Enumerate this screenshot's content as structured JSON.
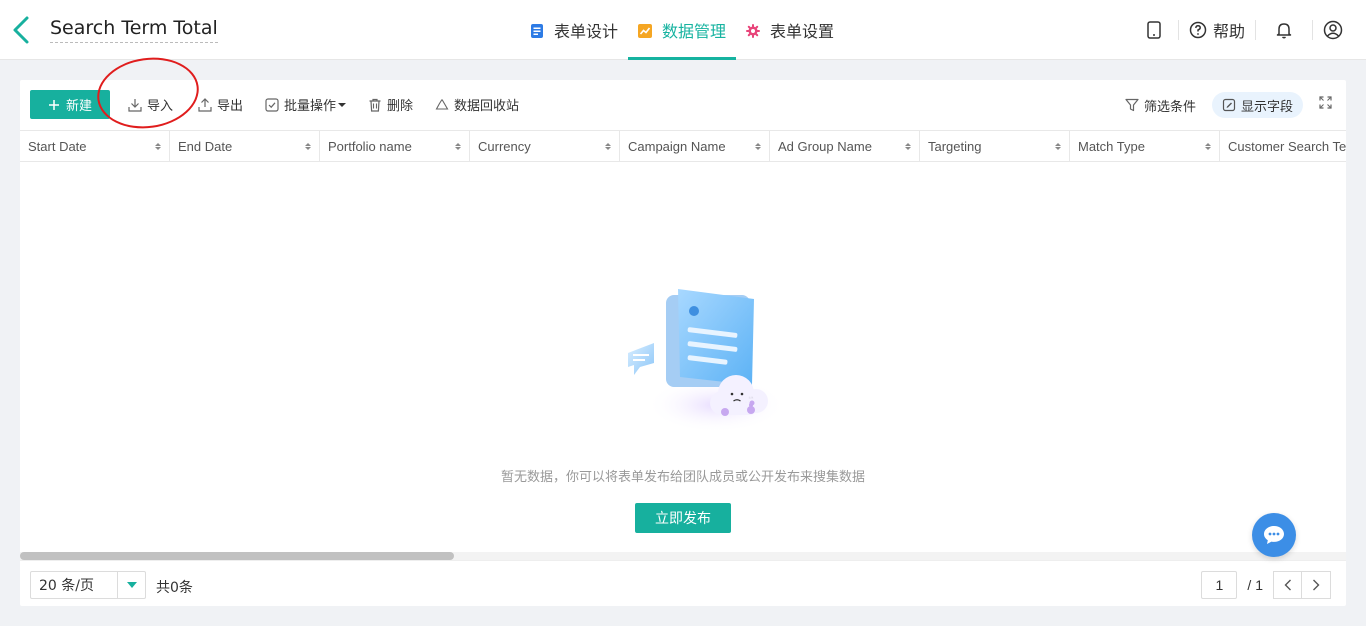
{
  "header": {
    "title": "Search Term Total",
    "tabs": [
      {
        "label": "表单设计",
        "icon": "form-icon"
      },
      {
        "label": "数据管理",
        "icon": "chart-icon"
      },
      {
        "label": "表单设置",
        "icon": "gear-icon"
      }
    ],
    "help_label": "帮助"
  },
  "toolbar": {
    "new_label": "新建",
    "import_label": "导入",
    "export_label": "导出",
    "batch_label": "批量操作",
    "delete_label": "删除",
    "recycle_label": "数据回收站",
    "filter_label": "筛选条件",
    "show_fields_label": "显示字段"
  },
  "table": {
    "columns": [
      "Start Date",
      "End Date",
      "Portfolio name",
      "Currency",
      "Campaign Name",
      "Ad Group Name",
      "Targeting",
      "Match Type",
      "Customer Search Te..."
    ]
  },
  "empty": {
    "message": "暂无数据，你可以将表单发布给团队成员或公开发布来搜集数据",
    "publish_label": "立即发布"
  },
  "footer": {
    "page_size": "20 条/页",
    "total": "共0条",
    "current_page": "1",
    "total_pages": "/ 1"
  },
  "colors": {
    "accent": "#17b09e",
    "annotation": "#e01d1d",
    "chat": "#3c8ee6"
  }
}
